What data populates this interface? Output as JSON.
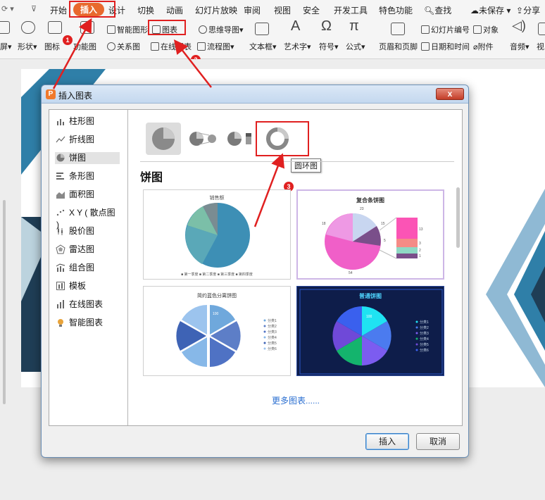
{
  "ribbon": {
    "quick_access": [
      "⟳ ▾",
      "⊽"
    ],
    "tabs": [
      "开始",
      "插入",
      "设计",
      "切换",
      "动画",
      "幻灯片放映",
      "审阅",
      "视图",
      "安全",
      "开发工具",
      "特色功能",
      "查找",
      "未保存",
      "分享"
    ],
    "active_tab": "插入",
    "tools": {
      "screen": "屏",
      "shapes": "形状",
      "icons": "图标",
      "func_chart": "功能图",
      "smart_graphic": "智能图形",
      "chart": "图表",
      "mind_map": "思维导图",
      "relation_graph": "关系图",
      "online_chart": "在线图表",
      "flowchart": "流程图",
      "textbox": "文本框",
      "wordart": "艺术字",
      "symbol": "符号",
      "formula": "公式",
      "header_footer": "页眉和页脚",
      "slide_number": "幻灯片编号",
      "datetime": "日期和时间",
      "object": "对象",
      "attachment": "附件",
      "audio": "音频",
      "video": "视"
    }
  },
  "annotations": [
    "1",
    "2",
    "3"
  ],
  "dialog": {
    "title": "插入图表",
    "close": "x",
    "categories": [
      "柱形图",
      "折线图",
      "饼图",
      "条形图",
      "面积图",
      "X Y ( 散点图 )",
      "股价图",
      "雷达图",
      "组合图",
      "模板",
      "在线图表",
      "智能图表"
    ],
    "selected_category": "饼图",
    "section_title": "饼图",
    "tooltip": "圆环图",
    "thumbnails": [
      {
        "title": "销售额",
        "legend": "■ 第一季度  ■ 第二季度  ■ 第三季度  ■ 第四季度"
      },
      {
        "title": "复合条饼图",
        "labels": [
          "23",
          "18",
          "15",
          "13",
          "5",
          "3",
          "2",
          "1",
          "54"
        ]
      },
      {
        "title": "简约蓝色分离饼图",
        "legend": [
          "分类1",
          "分类2",
          "分类3",
          "分类4",
          "分类5",
          "分类6"
        ],
        "label": "100"
      },
      {
        "title": "普通饼图",
        "legend": [
          "分类1",
          "分类2",
          "分类3",
          "分类4",
          "分类5",
          "分类6"
        ],
        "label": "100"
      }
    ],
    "more_link": "更多图表......",
    "insert_button": "插入",
    "cancel_button": "取消"
  },
  "colors": {
    "accent": "#e8692d",
    "highlight": "#e02020",
    "link": "#2b6fd1",
    "slide_blue": "#2f7fa8",
    "slide_dark": "#1f3e56"
  }
}
